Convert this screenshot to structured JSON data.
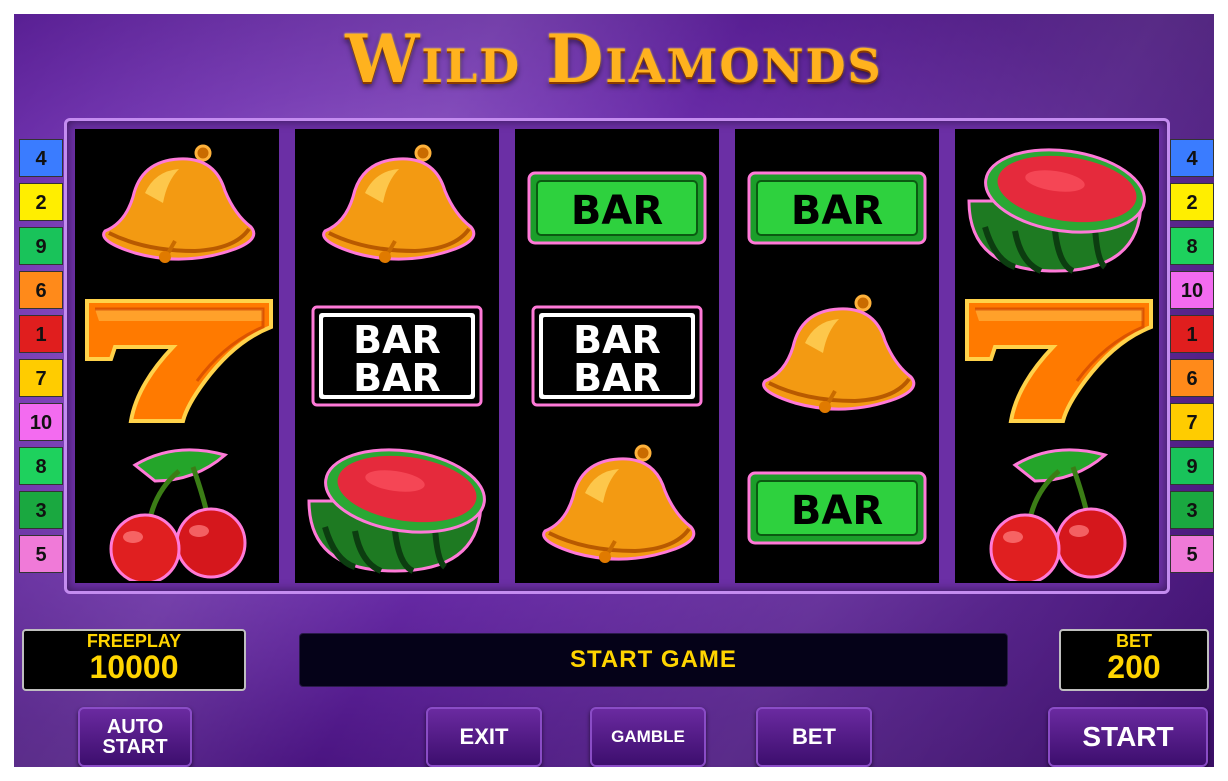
{
  "title": "Wild Diamonds",
  "reels": [
    [
      "bell",
      "seven",
      "cherry"
    ],
    [
      "bell",
      "double-bar",
      "watermelon"
    ],
    [
      "bar",
      "double-bar",
      "bell"
    ],
    [
      "bar",
      "bell",
      "bar"
    ],
    [
      "watermelon",
      "seven",
      "cherry"
    ]
  ],
  "symbol_text": {
    "bar": "BAR"
  },
  "left_lines": [
    {
      "label": "4",
      "color": "#3a7cff"
    },
    {
      "label": "2",
      "color": "#ffee00"
    },
    {
      "label": "9",
      "color": "#19c35a"
    },
    {
      "label": "6",
      "color": "#ff8a1a"
    },
    {
      "label": "1",
      "color": "#e01e1e"
    },
    {
      "label": "7",
      "color": "#ffcc00"
    },
    {
      "label": "10",
      "color": "#f36bf0"
    },
    {
      "label": "8",
      "color": "#1ed15d"
    },
    {
      "label": "3",
      "color": "#1aa840"
    },
    {
      "label": "5",
      "color": "#f07ad8"
    }
  ],
  "right_lines": [
    {
      "label": "4",
      "color": "#3a7cff"
    },
    {
      "label": "2",
      "color": "#ffee00"
    },
    {
      "label": "8",
      "color": "#1ed15d"
    },
    {
      "label": "10",
      "color": "#f36bf0"
    },
    {
      "label": "1",
      "color": "#e01e1e"
    },
    {
      "label": "6",
      "color": "#ff8a1a"
    },
    {
      "label": "7",
      "color": "#ffcc00"
    },
    {
      "label": "9",
      "color": "#19c35a"
    },
    {
      "label": "3",
      "color": "#1aa840"
    },
    {
      "label": "5",
      "color": "#f07ad8"
    }
  ],
  "freeplay": {
    "label": "FREEPLAY",
    "value": "10000"
  },
  "bet_display": {
    "label": "BET",
    "value": "200"
  },
  "message": "START GAME",
  "buttons": {
    "auto_start_line1": "AUTO",
    "auto_start_line2": "START",
    "exit": "EXIT",
    "gamble": "GAMBLE",
    "bet": "BET",
    "start": "START"
  }
}
